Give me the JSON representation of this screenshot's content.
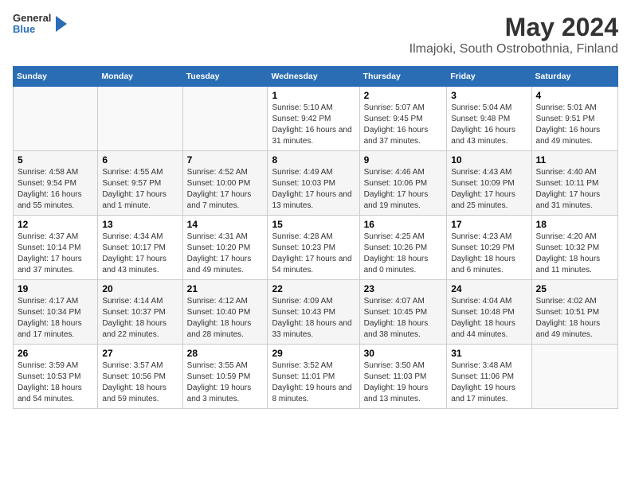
{
  "logo": {
    "general": "General",
    "blue": "Blue"
  },
  "header": {
    "title": "May 2024",
    "subtitle": "Ilmajoki, South Ostrobothnia, Finland"
  },
  "columns": [
    "Sunday",
    "Monday",
    "Tuesday",
    "Wednesday",
    "Thursday",
    "Friday",
    "Saturday"
  ],
  "weeks": [
    [
      {
        "day": "",
        "info": ""
      },
      {
        "day": "",
        "info": ""
      },
      {
        "day": "",
        "info": ""
      },
      {
        "day": "1",
        "info": "Sunrise: 5:10 AM\nSunset: 9:42 PM\nDaylight: 16 hours and 31 minutes."
      },
      {
        "day": "2",
        "info": "Sunrise: 5:07 AM\nSunset: 9:45 PM\nDaylight: 16 hours and 37 minutes."
      },
      {
        "day": "3",
        "info": "Sunrise: 5:04 AM\nSunset: 9:48 PM\nDaylight: 16 hours and 43 minutes."
      },
      {
        "day": "4",
        "info": "Sunrise: 5:01 AM\nSunset: 9:51 PM\nDaylight: 16 hours and 49 minutes."
      }
    ],
    [
      {
        "day": "5",
        "info": "Sunrise: 4:58 AM\nSunset: 9:54 PM\nDaylight: 16 hours and 55 minutes."
      },
      {
        "day": "6",
        "info": "Sunrise: 4:55 AM\nSunset: 9:57 PM\nDaylight: 17 hours and 1 minute."
      },
      {
        "day": "7",
        "info": "Sunrise: 4:52 AM\nSunset: 10:00 PM\nDaylight: 17 hours and 7 minutes."
      },
      {
        "day": "8",
        "info": "Sunrise: 4:49 AM\nSunset: 10:03 PM\nDaylight: 17 hours and 13 minutes."
      },
      {
        "day": "9",
        "info": "Sunrise: 4:46 AM\nSunset: 10:06 PM\nDaylight: 17 hours and 19 minutes."
      },
      {
        "day": "10",
        "info": "Sunrise: 4:43 AM\nSunset: 10:09 PM\nDaylight: 17 hours and 25 minutes."
      },
      {
        "day": "11",
        "info": "Sunrise: 4:40 AM\nSunset: 10:11 PM\nDaylight: 17 hours and 31 minutes."
      }
    ],
    [
      {
        "day": "12",
        "info": "Sunrise: 4:37 AM\nSunset: 10:14 PM\nDaylight: 17 hours and 37 minutes."
      },
      {
        "day": "13",
        "info": "Sunrise: 4:34 AM\nSunset: 10:17 PM\nDaylight: 17 hours and 43 minutes."
      },
      {
        "day": "14",
        "info": "Sunrise: 4:31 AM\nSunset: 10:20 PM\nDaylight: 17 hours and 49 minutes."
      },
      {
        "day": "15",
        "info": "Sunrise: 4:28 AM\nSunset: 10:23 PM\nDaylight: 17 hours and 54 minutes."
      },
      {
        "day": "16",
        "info": "Sunrise: 4:25 AM\nSunset: 10:26 PM\nDaylight: 18 hours and 0 minutes."
      },
      {
        "day": "17",
        "info": "Sunrise: 4:23 AM\nSunset: 10:29 PM\nDaylight: 18 hours and 6 minutes."
      },
      {
        "day": "18",
        "info": "Sunrise: 4:20 AM\nSunset: 10:32 PM\nDaylight: 18 hours and 11 minutes."
      }
    ],
    [
      {
        "day": "19",
        "info": "Sunrise: 4:17 AM\nSunset: 10:34 PM\nDaylight: 18 hours and 17 minutes."
      },
      {
        "day": "20",
        "info": "Sunrise: 4:14 AM\nSunset: 10:37 PM\nDaylight: 18 hours and 22 minutes."
      },
      {
        "day": "21",
        "info": "Sunrise: 4:12 AM\nSunset: 10:40 PM\nDaylight: 18 hours and 28 minutes."
      },
      {
        "day": "22",
        "info": "Sunrise: 4:09 AM\nSunset: 10:43 PM\nDaylight: 18 hours and 33 minutes."
      },
      {
        "day": "23",
        "info": "Sunrise: 4:07 AM\nSunset: 10:45 PM\nDaylight: 18 hours and 38 minutes."
      },
      {
        "day": "24",
        "info": "Sunrise: 4:04 AM\nSunset: 10:48 PM\nDaylight: 18 hours and 44 minutes."
      },
      {
        "day": "25",
        "info": "Sunrise: 4:02 AM\nSunset: 10:51 PM\nDaylight: 18 hours and 49 minutes."
      }
    ],
    [
      {
        "day": "26",
        "info": "Sunrise: 3:59 AM\nSunset: 10:53 PM\nDaylight: 18 hours and 54 minutes."
      },
      {
        "day": "27",
        "info": "Sunrise: 3:57 AM\nSunset: 10:56 PM\nDaylight: 18 hours and 59 minutes."
      },
      {
        "day": "28",
        "info": "Sunrise: 3:55 AM\nSunset: 10:59 PM\nDaylight: 19 hours and 3 minutes."
      },
      {
        "day": "29",
        "info": "Sunrise: 3:52 AM\nSunset: 11:01 PM\nDaylight: 19 hours and 8 minutes."
      },
      {
        "day": "30",
        "info": "Sunrise: 3:50 AM\nSunset: 11:03 PM\nDaylight: 19 hours and 13 minutes."
      },
      {
        "day": "31",
        "info": "Sunrise: 3:48 AM\nSunset: 11:06 PM\nDaylight: 19 hours and 17 minutes."
      },
      {
        "day": "",
        "info": ""
      }
    ]
  ]
}
